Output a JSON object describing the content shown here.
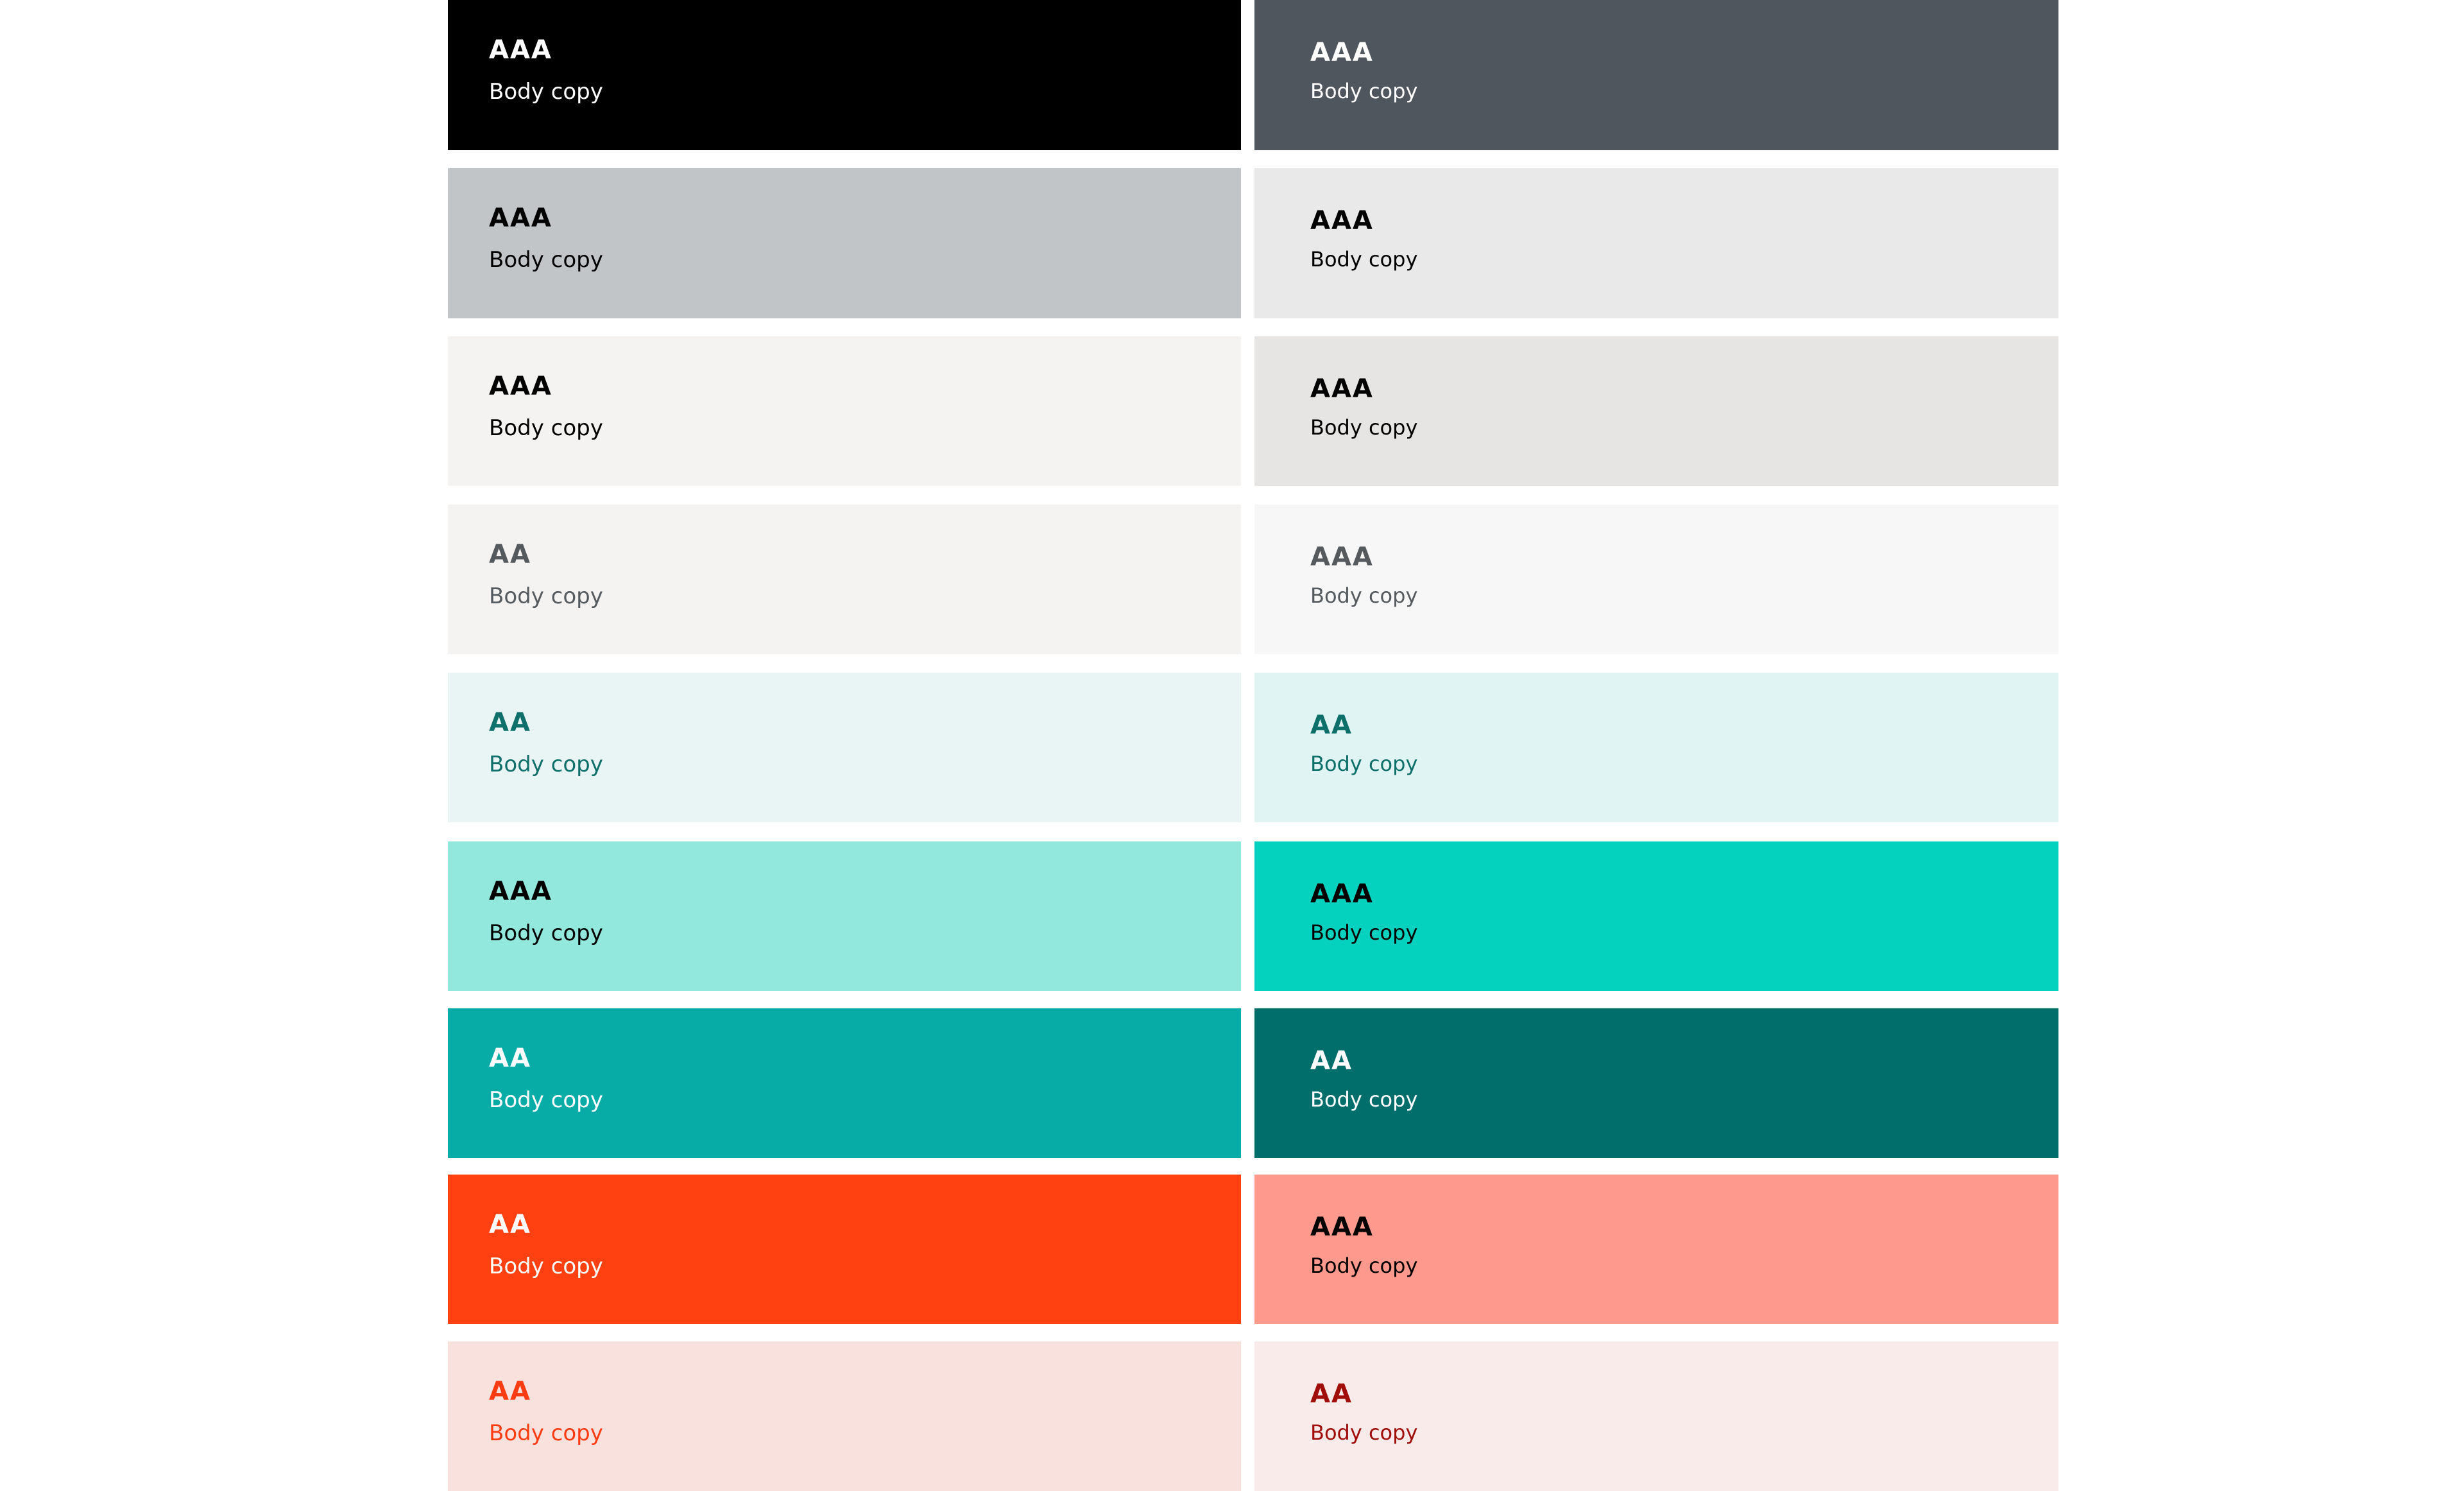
{
  "left": [
    {
      "bg": "#000000",
      "fg": "#ffffff",
      "rating": "AAA",
      "body": "Body copy"
    },
    {
      "bg": "#c1c5c7",
      "fg": "#000000",
      "rating": "AAA",
      "body": "Body copy"
    },
    {
      "bg": "#f4f3f1",
      "fg": "#000000",
      "rating": "AAA",
      "body": "Body copy"
    },
    {
      "bg": "#f4f3f1",
      "fg": "#555a5f",
      "rating": "AA",
      "body": "Body copy"
    },
    {
      "bg": "#e9f5f4",
      "fg": "#0e6f6b",
      "rating": "AA",
      "body": "Body copy"
    },
    {
      "bg": "#93e8dd",
      "fg": "#000000",
      "rating": "AAA",
      "body": "Body copy"
    },
    {
      "bg": "#08aca7",
      "fg": "#ffffff",
      "rating": "AA",
      "body": "Body copy"
    },
    {
      "bg": "#ff4111",
      "fg": "#ffffff",
      "rating": "AA",
      "body": "Body copy"
    },
    {
      "bg": "#f9e1de",
      "fg": "#ff3c11",
      "rating": "AA",
      "body": "Body copy"
    }
  ],
  "right": [
    {
      "bg": "#50565d",
      "fg": "#ffffff",
      "rating": "AAA",
      "body": "Body copy"
    },
    {
      "bg": "#e9e9e9",
      "fg": "#000000",
      "rating": "AAA",
      "body": "Body copy"
    },
    {
      "bg": "#e6e5e3",
      "fg": "#000000",
      "rating": "AAA",
      "body": "Body copy"
    },
    {
      "bg": "#f7f7f7",
      "fg": "#555a5f",
      "rating": "AAA",
      "body": "Body copy"
    },
    {
      "bg": "#e0f4f3",
      "fg": "#0c6f69",
      "rating": "AA",
      "body": "Body copy"
    },
    {
      "bg": "#04d2be",
      "fg": "#000000",
      "rating": "AAA",
      "body": "Body copy"
    },
    {
      "bg": "#016e6b",
      "fg": "#ffffff",
      "rating": "AA",
      "body": "Body copy"
    },
    {
      "bg": "#fd9a8d",
      "fg": "#000000",
      "rating": "AAA",
      "body": "Body copy"
    },
    {
      "bg": "#f9ebe9",
      "fg": "#a00e0a",
      "rating": "AA",
      "body": "Body copy"
    }
  ]
}
